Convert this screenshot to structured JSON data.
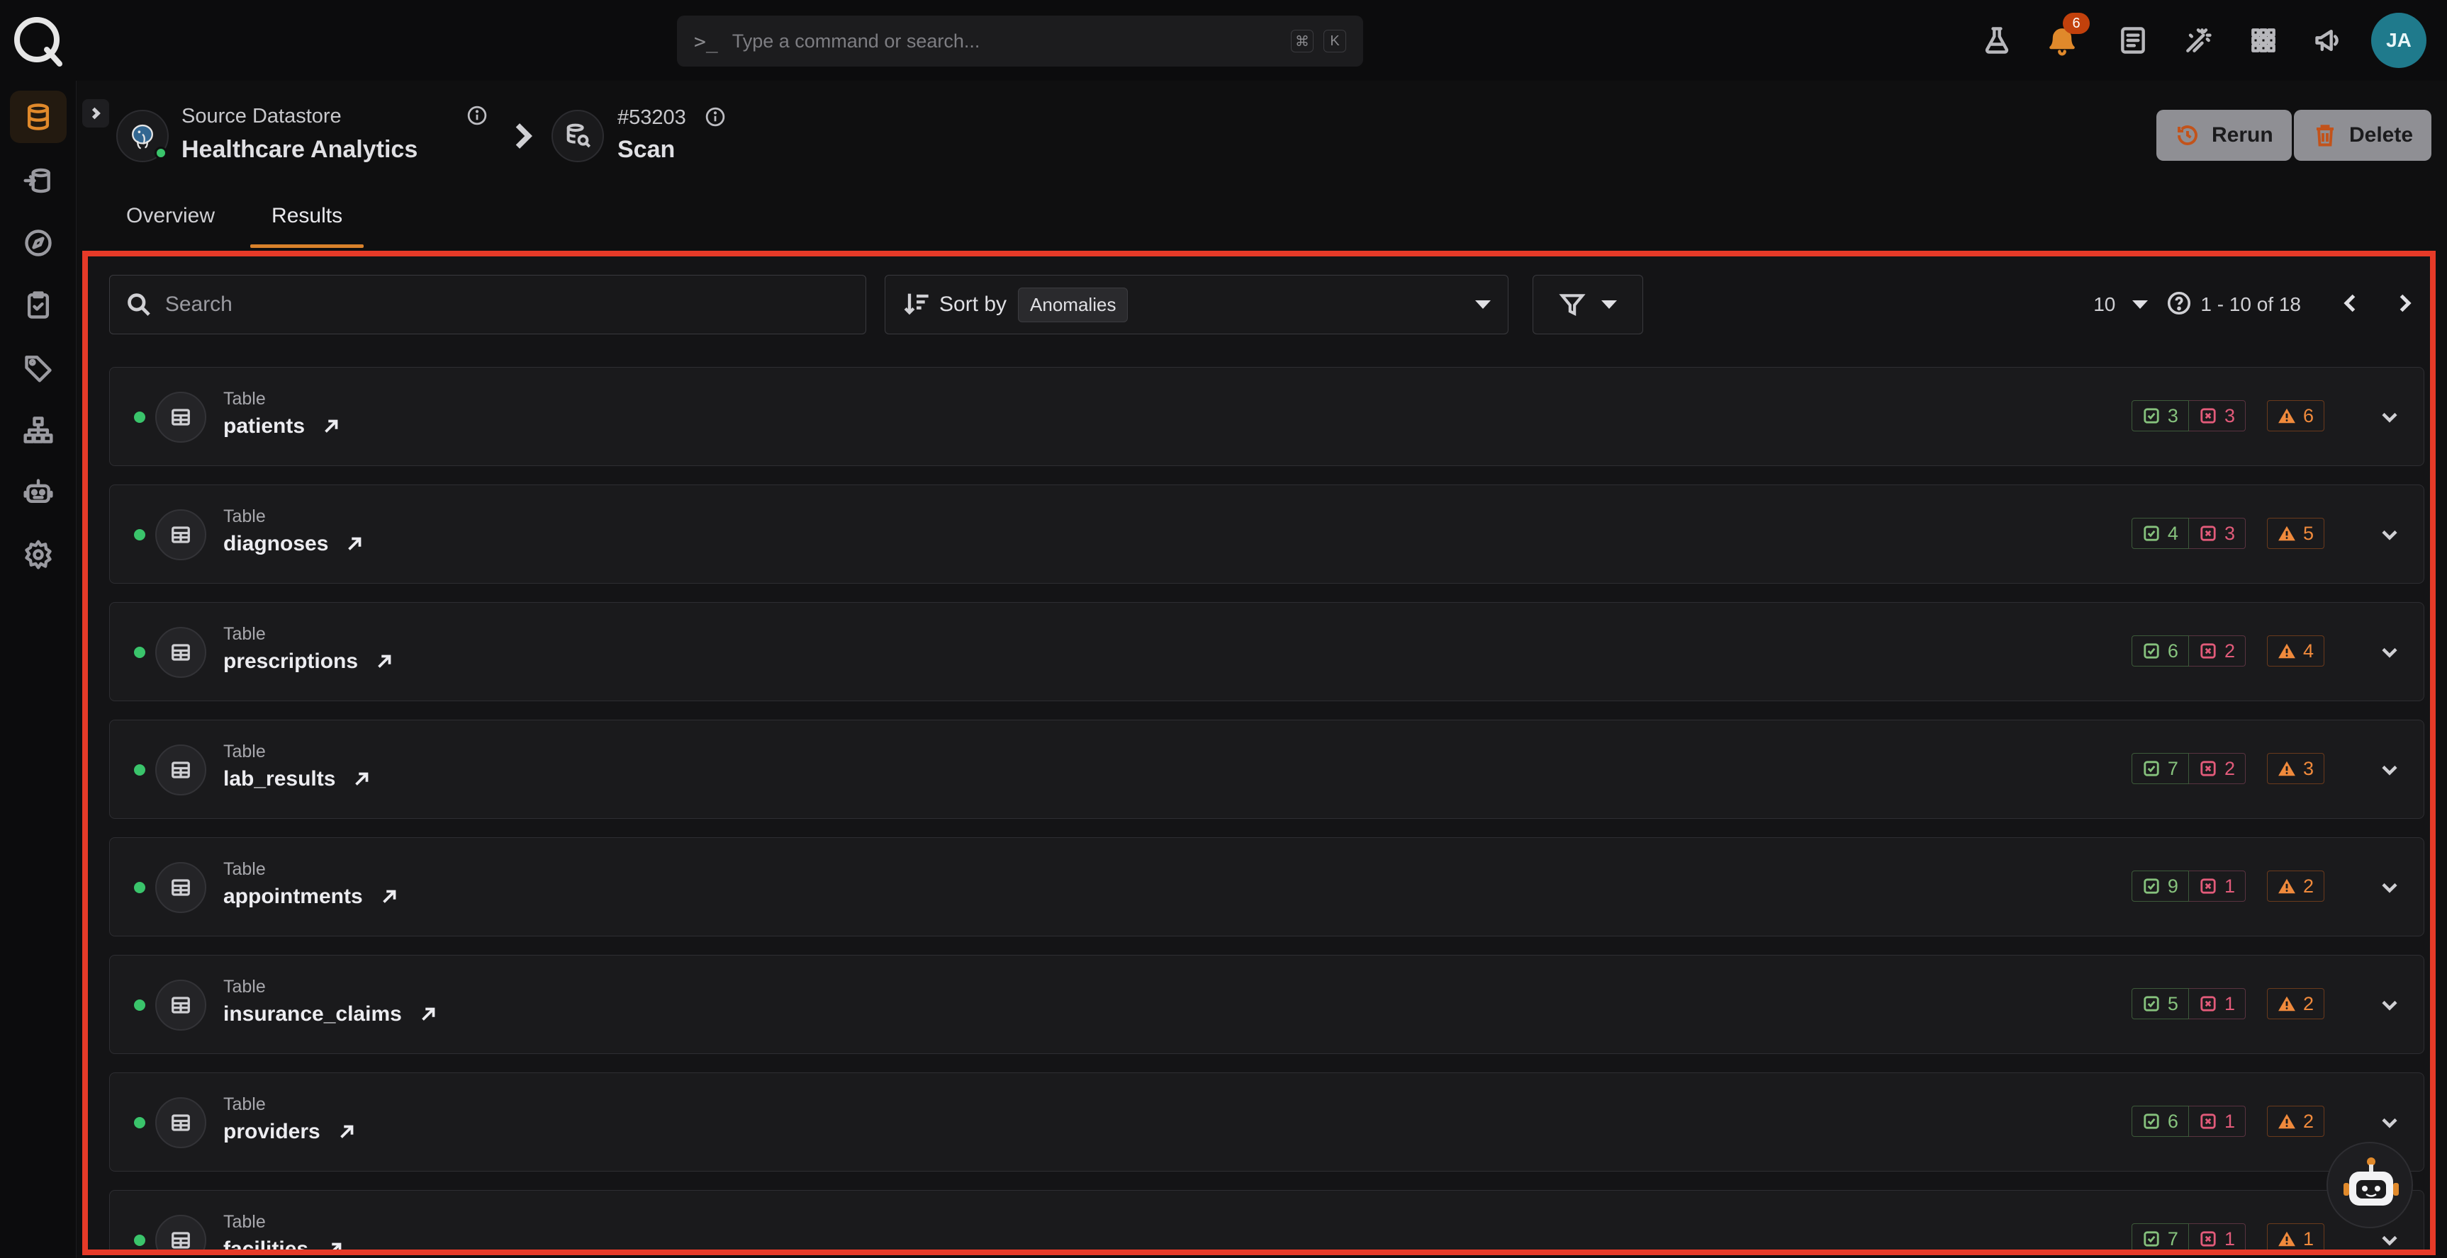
{
  "command_bar": {
    "placeholder": "Type a command or search...",
    "shortcut_mod": "⌘",
    "shortcut_key": "K"
  },
  "notifications": {
    "count": "6"
  },
  "user": {
    "initials": "JA"
  },
  "header": {
    "datastore_label": "Source Datastore",
    "datastore_name": "Healthcare Analytics",
    "scan_id": "#53203",
    "scan_label": "Scan",
    "rerun_label": "Rerun",
    "delete_label": "Delete"
  },
  "tabs": [
    {
      "label": "Overview",
      "active": false
    },
    {
      "label": "Results",
      "active": true
    }
  ],
  "toolbar": {
    "search_placeholder": "Search",
    "sort_label": "Sort by",
    "sort_value": "Anomalies",
    "per_page": "10",
    "range": "1 - 10 of 18"
  },
  "rows": [
    {
      "type": "Table",
      "name": "patients",
      "passed": "3",
      "failed": "3",
      "anomalies": "6"
    },
    {
      "type": "Table",
      "name": "diagnoses",
      "passed": "4",
      "failed": "3",
      "anomalies": "5"
    },
    {
      "type": "Table",
      "name": "prescriptions",
      "passed": "6",
      "failed": "2",
      "anomalies": "4"
    },
    {
      "type": "Table",
      "name": "lab_results",
      "passed": "7",
      "failed": "2",
      "anomalies": "3"
    },
    {
      "type": "Table",
      "name": "appointments",
      "passed": "9",
      "failed": "1",
      "anomalies": "2"
    },
    {
      "type": "Table",
      "name": "insurance_claims",
      "passed": "5",
      "failed": "1",
      "anomalies": "2"
    },
    {
      "type": "Table",
      "name": "providers",
      "passed": "6",
      "failed": "1",
      "anomalies": "2"
    },
    {
      "type": "Table",
      "name": "facilities",
      "passed": "7",
      "failed": "1",
      "anomalies": "1"
    }
  ],
  "colors": {
    "accent": "#e0892b",
    "highlight_border": "#e63a28",
    "status_ok": "#3ac46b",
    "passed": "#86c27d",
    "failed": "#e25b7a",
    "anomaly": "#f08a3c"
  },
  "icons": {
    "rail": [
      "database-icon",
      "source-icon",
      "compass-icon",
      "clipboard-check-icon",
      "tag-icon",
      "hierarchy-icon",
      "robot-icon",
      "gear-icon"
    ],
    "topbar": [
      "flask-icon",
      "bell-icon",
      "document-icon",
      "magic-wand-icon",
      "apps-grid-icon",
      "megaphone-icon"
    ]
  }
}
